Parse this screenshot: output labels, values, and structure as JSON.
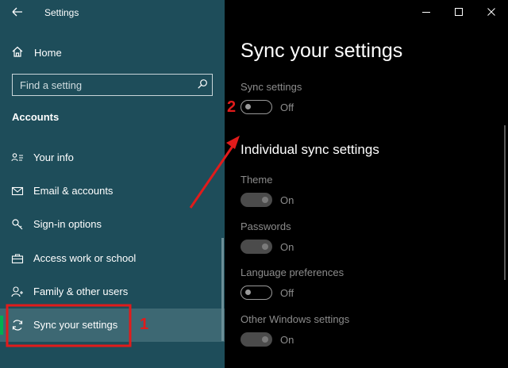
{
  "window": {
    "title": "Settings"
  },
  "sidebar": {
    "home_label": "Home",
    "search_placeholder": "Find a setting",
    "section": "Accounts",
    "items": [
      {
        "label": "Your info",
        "icon": "person-card-icon"
      },
      {
        "label": "Email & accounts",
        "icon": "envelope-icon"
      },
      {
        "label": "Sign-in options",
        "icon": "key-icon"
      },
      {
        "label": "Access work or school",
        "icon": "briefcase-icon"
      },
      {
        "label": "Family & other users",
        "icon": "person-add-icon"
      },
      {
        "label": "Sync your settings",
        "icon": "sync-icon",
        "selected": true
      }
    ]
  },
  "main": {
    "title": "Sync your settings",
    "sync_settings": {
      "label": "Sync settings",
      "state": "Off"
    },
    "individual_heading": "Individual sync settings",
    "individual": [
      {
        "label": "Theme",
        "state": "On"
      },
      {
        "label": "Passwords",
        "state": "On"
      },
      {
        "label": "Language preferences",
        "state": "Off"
      },
      {
        "label": "Other Windows settings",
        "state": "On"
      }
    ]
  },
  "annotations": {
    "marker_1": "1",
    "marker_2": "2"
  },
  "colors": {
    "sidebar_bg": "#1e4d5a",
    "selected_bg": "#3d6873",
    "selected_accent": "#00b050",
    "content_bg": "#000000",
    "annotation_red": "#e11b1b"
  }
}
